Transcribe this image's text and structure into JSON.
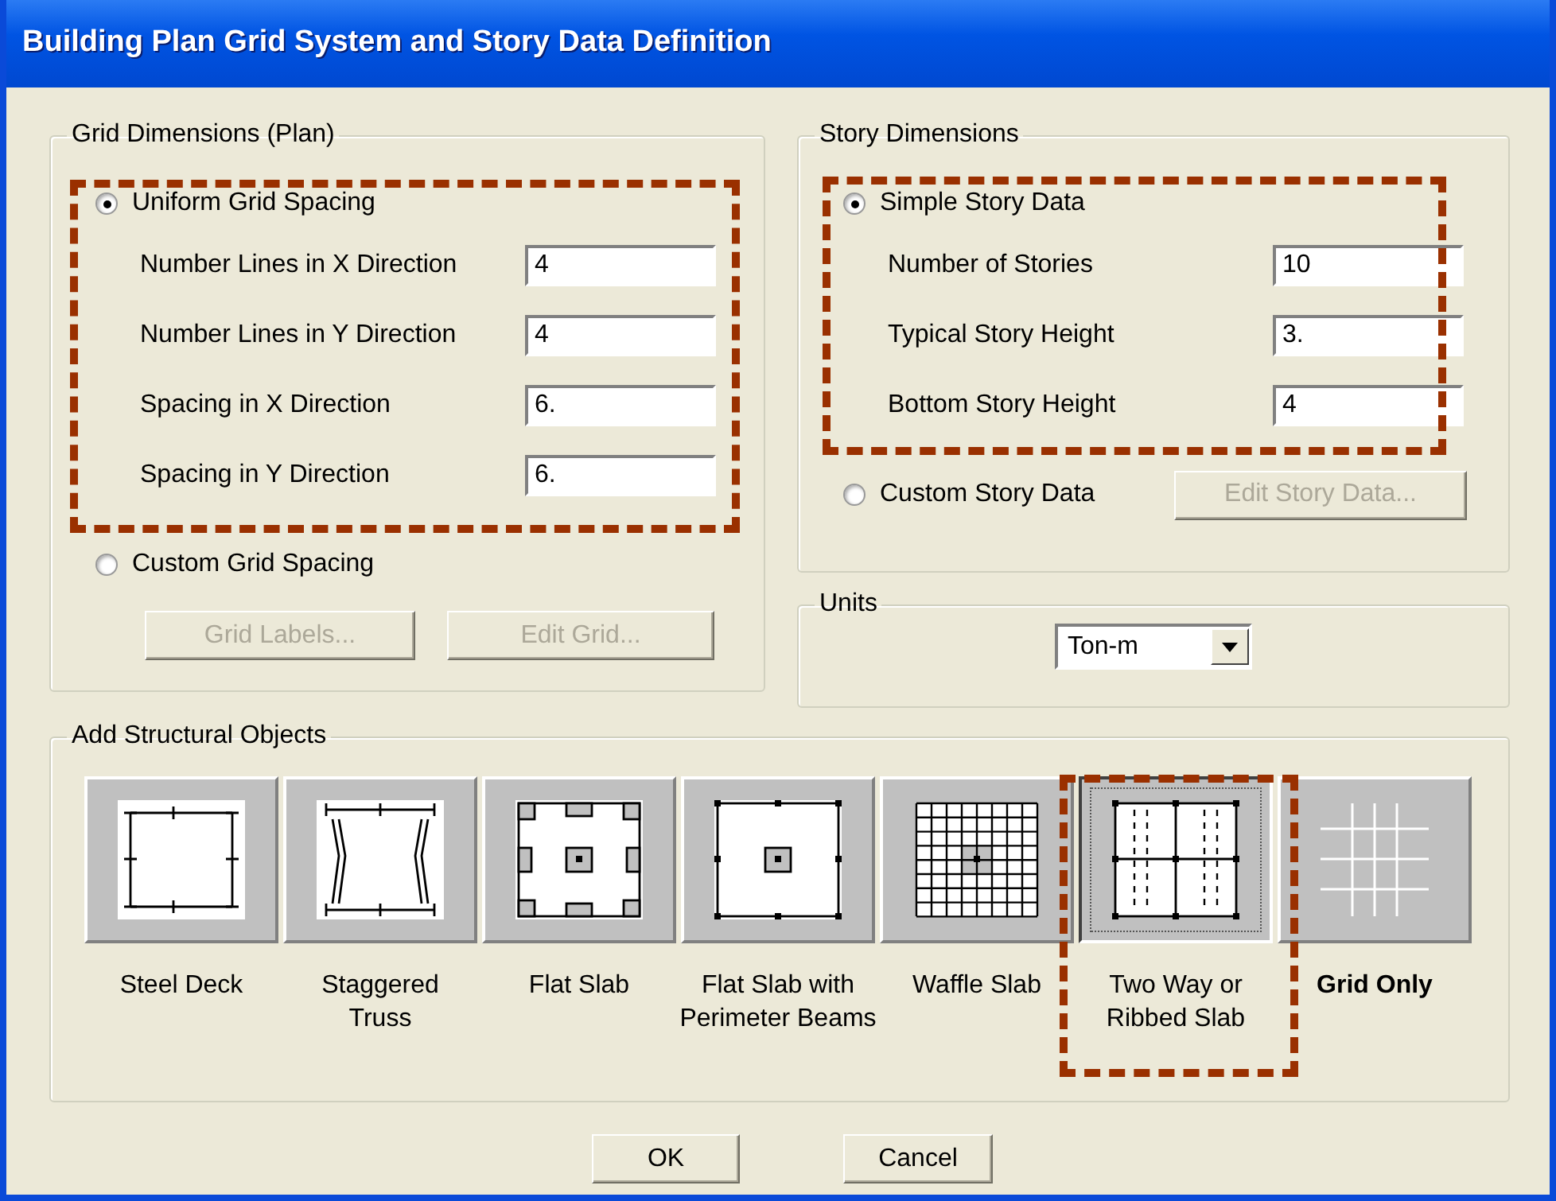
{
  "window": {
    "title": "Building Plan Grid System and Story Data Definition"
  },
  "grid_dimensions": {
    "title": "Grid Dimensions (Plan)",
    "highlighted": true,
    "options": [
      {
        "label": "Uniform Grid Spacing",
        "selected": true
      },
      {
        "label": "Custom Grid Spacing",
        "selected": false
      }
    ],
    "fields": [
      {
        "label": "Number Lines in X Direction",
        "value": "4"
      },
      {
        "label": "Number Lines in Y Direction",
        "value": "4"
      },
      {
        "label": "Spacing in X Direction",
        "value": "6."
      },
      {
        "label": "Spacing in Y Direction",
        "value": "6."
      }
    ],
    "buttons": [
      {
        "label": "Grid Labels...",
        "disabled": true
      },
      {
        "label": "Edit Grid...",
        "disabled": true
      }
    ]
  },
  "story_dimensions": {
    "title": "Story Dimensions",
    "highlighted": true,
    "options": [
      {
        "label": "Simple Story Data",
        "selected": true
      },
      {
        "label": "Custom Story Data",
        "selected": false
      }
    ],
    "fields": [
      {
        "label": "Number of Stories",
        "value": "10"
      },
      {
        "label": "Typical Story Height",
        "value": "3."
      },
      {
        "label": "Bottom Story Height",
        "value": "4"
      }
    ],
    "button": {
      "label": "Edit Story Data...",
      "disabled": true
    }
  },
  "units": {
    "title": "Units",
    "value": "Ton-m"
  },
  "structural_objects": {
    "title": "Add Structural Objects",
    "items": [
      {
        "kind": "steel-deck",
        "label": "Steel Deck",
        "pressed": false,
        "bold": false,
        "highlighted": false
      },
      {
        "kind": "staggered-truss",
        "label": "Staggered\nTruss",
        "pressed": false,
        "bold": false,
        "highlighted": false
      },
      {
        "kind": "flat-slab",
        "label": "Flat Slab",
        "pressed": false,
        "bold": false,
        "highlighted": false
      },
      {
        "kind": "flat-slab-perimeter",
        "label": "Flat Slab with\nPerimeter Beams",
        "pressed": false,
        "bold": false,
        "highlighted": false
      },
      {
        "kind": "waffle-slab",
        "label": "Waffle Slab",
        "pressed": false,
        "bold": false,
        "highlighted": false
      },
      {
        "kind": "two-way-slab",
        "label": "Two Way or\nRibbed Slab",
        "pressed": true,
        "bold": false,
        "highlighted": true
      },
      {
        "kind": "grid-only",
        "label": "Grid Only",
        "pressed": false,
        "bold": true,
        "highlighted": false
      }
    ]
  },
  "buttons": [
    "OK",
    "Cancel"
  ]
}
